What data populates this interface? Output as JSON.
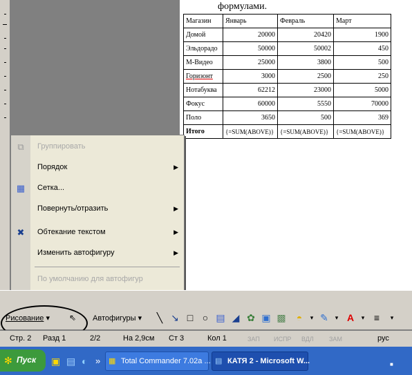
{
  "document": {
    "heading": "формулами.",
    "table": {
      "header": [
        "Магазин",
        "Январь",
        "Февраль",
        "Март"
      ],
      "rows": [
        [
          "Домой",
          "20000",
          "20420",
          "1900"
        ],
        [
          "Эльдорадо",
          "50000",
          "50002",
          "450"
        ],
        [
          "М-Видео",
          "25000",
          "3800",
          "500"
        ],
        [
          "Горизонт",
          "3000",
          "2500",
          "250"
        ],
        [
          "Нотабуква",
          "62212",
          "23000",
          "5000"
        ],
        [
          "Фокус",
          "60000",
          "5550",
          "70000"
        ],
        [
          "Поло",
          "3650",
          "500",
          "369"
        ]
      ],
      "totals": [
        "Итого",
        "{=SUM(ABOVE)}",
        "{=SUM(ABOVE)}",
        "{=SUM(ABOVE)}"
      ]
    }
  },
  "menu": {
    "group": "Группировать",
    "order": "Порядок",
    "grid": "Сетка...",
    "rotate": "Повернуть/отразить",
    "wrap": "Обтекание текстом",
    "change_shape": "Изменить автофигуру",
    "default": "По умолчанию для автофигур",
    "expand": "»"
  },
  "drawing_toolbar": {
    "drawing": "Рисование",
    "autoshapes": "Автофигуры"
  },
  "status_bar": {
    "page": "Стр. 2",
    "section": "Разд 1",
    "pages": "2/2",
    "at": "На 2,9см",
    "line": "Ст 3",
    "col": "Кол 1",
    "rec": "ЗАП",
    "trk": "ИСПР",
    "ext": "ВДЛ",
    "ovr": "ЗАМ",
    "lang": "рус"
  },
  "taskbar": {
    "start": "Пуск",
    "more": "»",
    "task1": "Total Commander 7.02a ...",
    "task2": "КАТЯ 2 - Microsoft W..."
  },
  "colors": {
    "taskbar": "#3169c6",
    "start": "#3c9a3c",
    "menu_bg": "#ece9d8",
    "toolbar_bg": "#d4d0c8"
  }
}
